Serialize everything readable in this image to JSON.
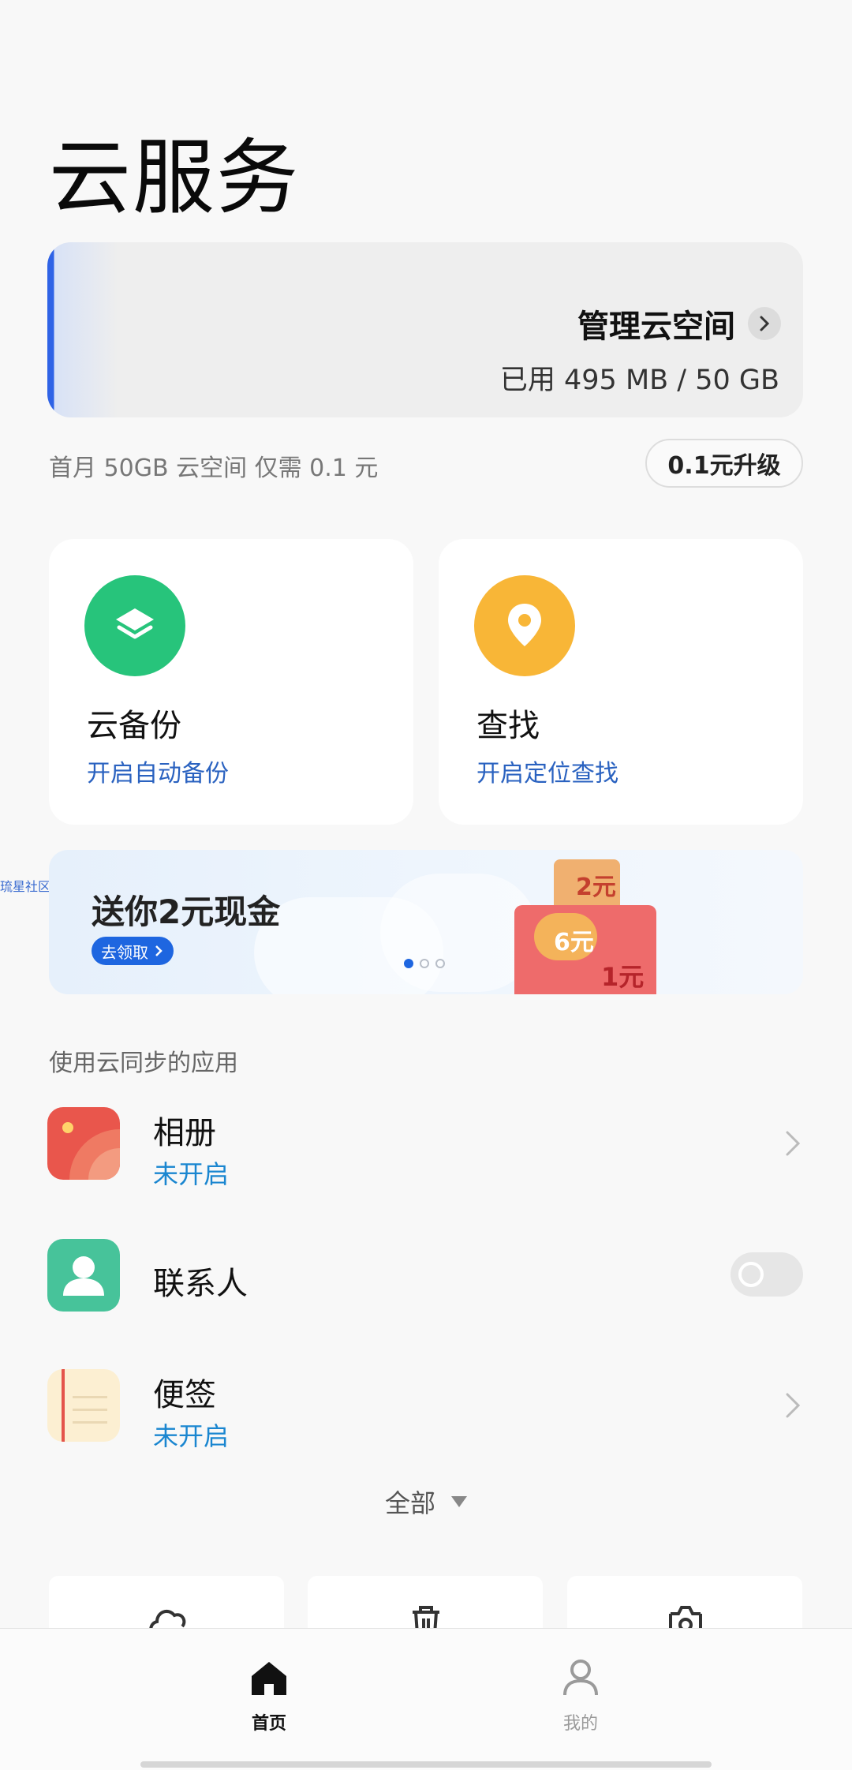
{
  "page": {
    "title": "云服务"
  },
  "storage": {
    "manage_label": "管理云空间",
    "used_text": "已用 495 MB / 50 GB",
    "used_fraction": 0.0097,
    "accent": "#2f63e6"
  },
  "promo": {
    "text": "首月 50GB 云空间 仅需 0.1 元",
    "button_label": "0.1元升级"
  },
  "features": [
    {
      "title": "云备份",
      "subtitle": "开启自动备份",
      "icon": "backup-layers-icon",
      "color": "#27c47b"
    },
    {
      "title": "查找",
      "subtitle": "开启定位查找",
      "icon": "location-pin-icon",
      "color": "#f8b637"
    }
  ],
  "side_tag": "琉星社区",
  "banner": {
    "title": "送你2元现金",
    "button_label": "去领取",
    "dots": 3,
    "active_dot": 0,
    "gift_labels": [
      "2元",
      "6元",
      "1元"
    ]
  },
  "section": {
    "label": "使用云同步的应用"
  },
  "apps": [
    {
      "name": "相册",
      "status": "未开启",
      "icon": "gallery-icon",
      "control": "chevron"
    },
    {
      "name": "联系人",
      "status": "",
      "icon": "contacts-icon",
      "control": "toggle",
      "toggle_on": false
    },
    {
      "name": "便签",
      "status": "未开启",
      "icon": "notes-icon",
      "control": "chevron"
    }
  ],
  "all": {
    "label": "全部"
  },
  "tools": [
    {
      "icon": "cloud-icon"
    },
    {
      "icon": "trash-icon"
    },
    {
      "icon": "camera-icon"
    }
  ],
  "nav": {
    "home_label": "首页",
    "mine_label": "我的",
    "active": "home"
  }
}
